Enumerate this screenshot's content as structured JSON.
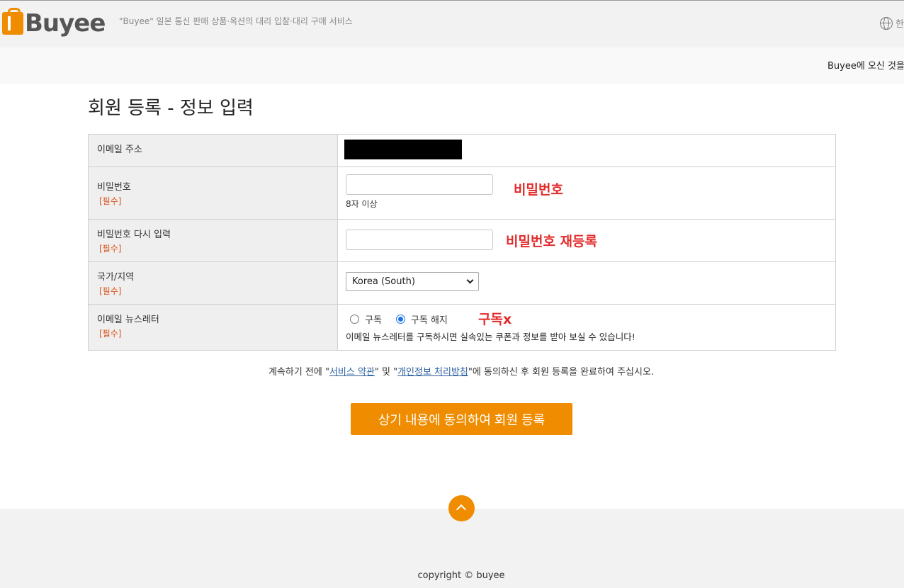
{
  "header": {
    "logo_text": "Buyee",
    "tagline": "\"Buyee\" 일본 통신 판매 상품·옥션의 대리 입찰·대리 구매 서비스",
    "language_label": "한",
    "welcome_text": "Buyee에 오신 것을"
  },
  "page": {
    "title": "회원 등록 - 정보 입력"
  },
  "form": {
    "required_tag": "[필수]",
    "email": {
      "label": "이메일 주소"
    },
    "password": {
      "label": "비밀번호",
      "value": "",
      "hint": "8자 이상",
      "annotation": "비밀번호"
    },
    "password_confirm": {
      "label": "비밀번호 다시 입력",
      "value": "",
      "annotation": "비밀번호 재등록"
    },
    "country": {
      "label": "국가/지역",
      "selected": "Korea (South)"
    },
    "newsletter": {
      "label": "이메일 뉴스레터",
      "option_subscribe": "구독",
      "option_unsubscribe": "구독 해지",
      "selected": "구독 해지",
      "annotation": "구독x",
      "description": "이메일 뉴스레터를 구독하시면 실속있는 쿠폰과 정보를 받아 보실 수 있습니다!"
    }
  },
  "agreement": {
    "prefix": "계속하기 전에 \"",
    "terms_link": "서비스 약관",
    "middle": "\" 및 \"",
    "privacy_link": "개인정보 처리방침",
    "suffix": "\"에 동의하신 후 회원 등록을 완료하여 주십시오."
  },
  "submit_label": "상기 내용에 동의하여 회원 등록",
  "footer": {
    "copyright": "copyright © buyee"
  },
  "colors": {
    "accent": "#f08c00",
    "annotation_red": "#e32b2b",
    "required_red": "#d9541e"
  }
}
